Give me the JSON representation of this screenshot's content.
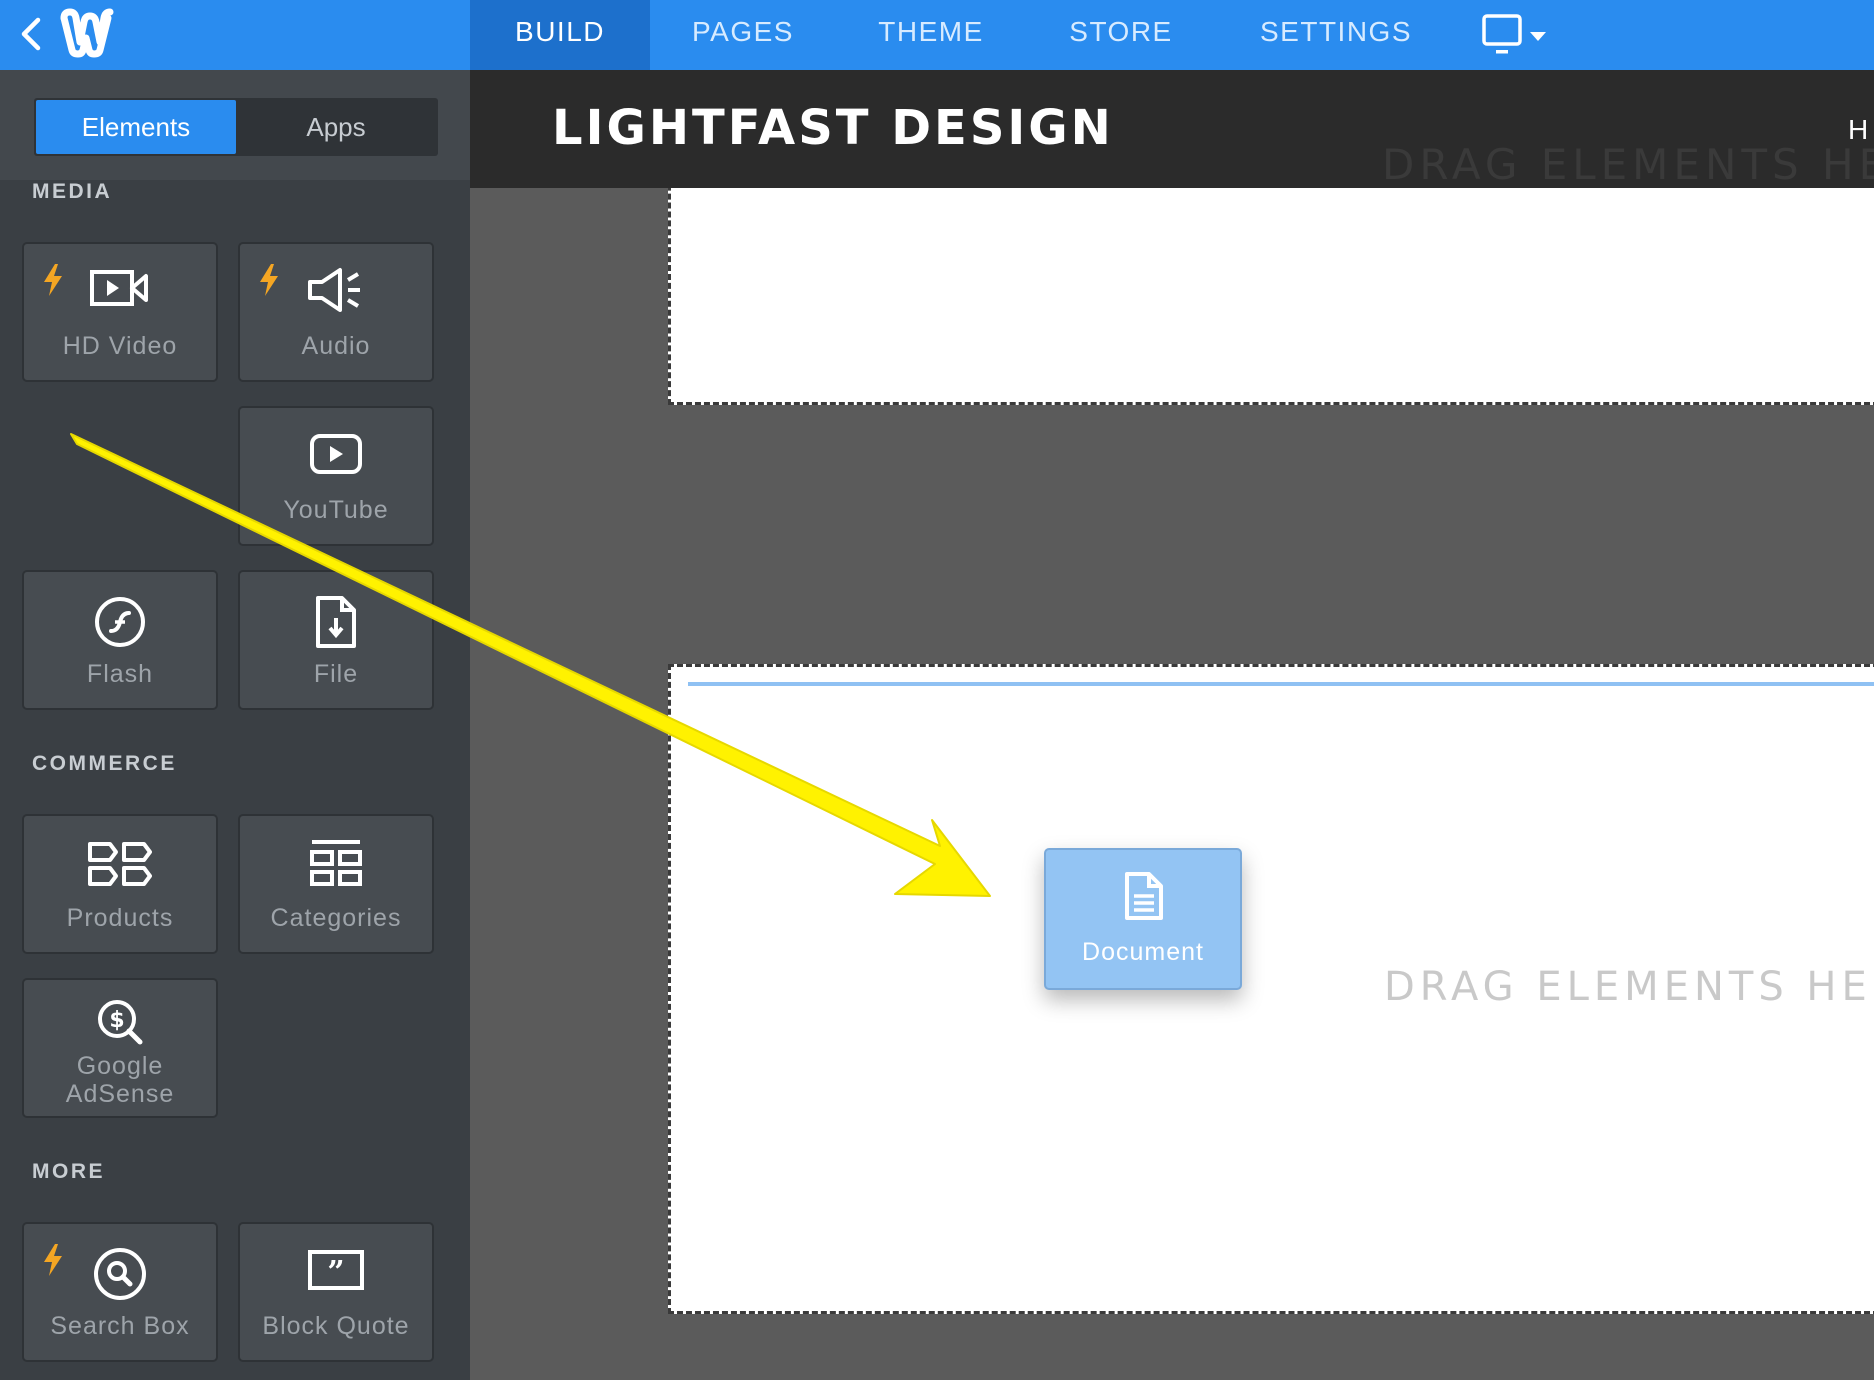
{
  "topbar": {
    "tabs": [
      {
        "label": "BUILD",
        "active": true
      },
      {
        "label": "PAGES",
        "active": false
      },
      {
        "label": "THEME",
        "active": false
      },
      {
        "label": "STORE",
        "active": false
      },
      {
        "label": "SETTINGS",
        "active": false
      }
    ],
    "icons": {
      "back": "chevron-left-icon",
      "logo": "weebly-logo-icon",
      "device": "desktop-monitor-icon"
    },
    "accent_color": "#2a8cef"
  },
  "sidebar": {
    "toggle": [
      {
        "label": "Elements",
        "active": true
      },
      {
        "label": "Apps",
        "active": false
      }
    ],
    "sections": {
      "media": {
        "label": "MEDIA",
        "items": [
          {
            "label": "HD Video",
            "icon": "video-camera-icon",
            "badge": "bolt-icon"
          },
          {
            "label": "Audio",
            "icon": "speaker-icon",
            "badge": "bolt-icon"
          },
          {
            "label": "YouTube",
            "icon": "youtube-icon"
          },
          {
            "label": "Flash",
            "icon": "flash-icon"
          },
          {
            "label": "File",
            "icon": "file-download-icon"
          }
        ]
      },
      "commerce": {
        "label": "COMMERCE",
        "items": [
          {
            "label": "Products",
            "icon": "products-icon"
          },
          {
            "label": "Categories",
            "icon": "categories-icon"
          },
          {
            "label_line1": "Google",
            "label_line2": "AdSense",
            "icon": "adsense-icon"
          }
        ]
      },
      "more": {
        "label": "MORE",
        "items": [
          {
            "label": "Search Box",
            "icon": "search-icon",
            "badge": "bolt-icon"
          },
          {
            "label": "Block Quote",
            "icon": "quote-icon"
          }
        ]
      }
    }
  },
  "canvas": {
    "site_title": "LIGHTFAST DESIGN",
    "header_nav_partial": "H",
    "ghost_text": "DRAG ELEMENTS HERE",
    "drop_hint": "DRAG ELEMENTS HERE",
    "dragging_element": {
      "label": "Document",
      "icon": "document-icon"
    }
  },
  "annotation": {
    "arrow_color": "#ffff00"
  }
}
